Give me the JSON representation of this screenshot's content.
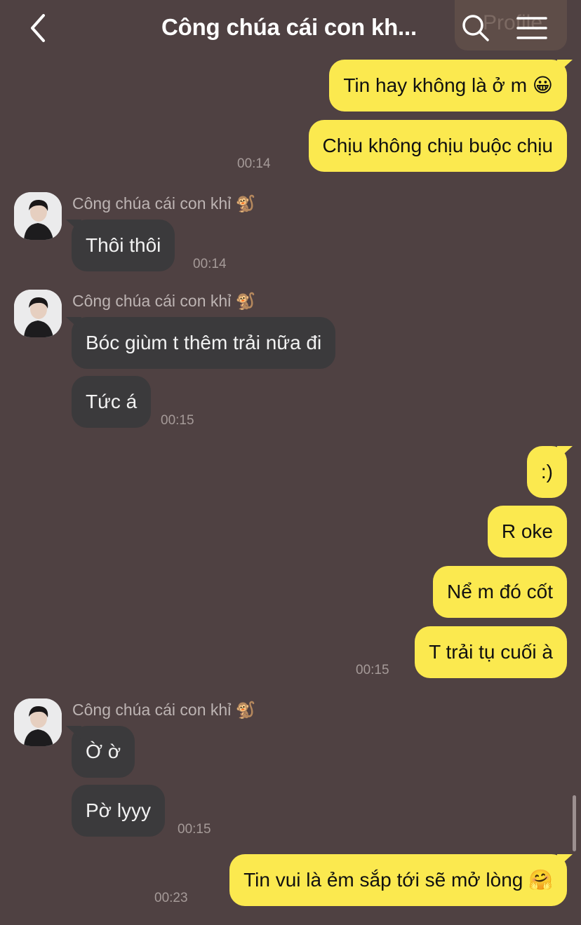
{
  "header": {
    "title": "Công chúa cái con kh...",
    "ghost_text": "Profile"
  },
  "messages": [
    {
      "id": "m1",
      "direction": "out",
      "text": "Tin hay không là ở m 😀"
    },
    {
      "id": "m2",
      "direction": "out",
      "text": "Chịu không chịu buộc chịu",
      "time": "00:14"
    },
    {
      "id": "m3",
      "direction": "in",
      "sender": "Công chúa cái con khỉ 🐒",
      "text": "Thôi thôi",
      "time": "00:14"
    },
    {
      "id": "m4",
      "direction": "in",
      "sender": "Công chúa cái con khỉ 🐒",
      "text": "Bóc giùm t thêm trải nữa đi"
    },
    {
      "id": "m5",
      "direction": "in",
      "text": "Tức á",
      "time": "00:15"
    },
    {
      "id": "m6",
      "direction": "out",
      "text": ":)"
    },
    {
      "id": "m7",
      "direction": "out",
      "text": "R oke"
    },
    {
      "id": "m8",
      "direction": "out",
      "text": "Nể m đó cốt"
    },
    {
      "id": "m9",
      "direction": "out",
      "text": "T trải tụ cuối à",
      "time": "00:15"
    },
    {
      "id": "m10",
      "direction": "in",
      "sender": "Công chúa cái con khỉ 🐒",
      "text": "Ờ ờ"
    },
    {
      "id": "m11",
      "direction": "in",
      "text": "Pờ lyyy",
      "time": "00:15"
    },
    {
      "id": "m12",
      "direction": "out",
      "text": "Tin vui là ẻm sắp tới sẽ mở lòng 🤗",
      "time": "00:23"
    }
  ],
  "colors": {
    "background": "#4f4142",
    "outgoing_bubble": "#fbe94f",
    "incoming_bubble": "#3b3a3c"
  }
}
